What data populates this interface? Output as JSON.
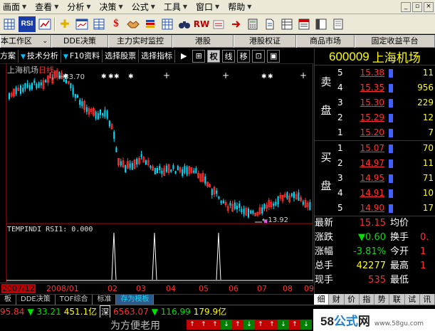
{
  "menubar": {
    "items": [
      {
        "label": "画面"
      },
      {
        "label": "查看"
      },
      {
        "label": "分析"
      },
      {
        "label": "决策"
      },
      {
        "label": "公式"
      },
      {
        "label": "工具"
      },
      {
        "label": "窗口"
      },
      {
        "label": "帮助"
      }
    ],
    "window_controls": [
      "_",
      "▫",
      "×"
    ]
  },
  "toolbar": {
    "icons": [
      "grid-icon",
      "rsi-icon",
      "chart-icon",
      "cross-icon",
      "chart-window-icon",
      "grid-icon",
      "dollar-icon",
      "handshake-icon",
      "stack-icon",
      "grid-icon",
      "binoculars-icon",
      "rw-icon",
      "stack-icon",
      "arrow-icon",
      "calculator-icon",
      "document-icon",
      "grid-icon",
      "list-icon",
      "panel-icon",
      "page-icon"
    ],
    "rsi_label": "RSI",
    "rw_label": "RW"
  },
  "tabs_top": [
    "本工作区",
    "DDE决策",
    "主力实时监控",
    "港股",
    "港股权证",
    "商品市场",
    "固定收益平台"
  ],
  "tabs_second": [
    "方案",
    "技术分析",
    "F10资料",
    "选择股票",
    "选择指标"
  ],
  "chart_toolbar": {
    "play": "▶",
    "plus": "⊞",
    "quan": "权",
    "xian": "线",
    "yi": "移",
    "zoom": "⊡",
    "copy": "▣"
  },
  "chart": {
    "stock_name": "上海机场",
    "period": "日线",
    "high_label": "←33.70",
    "low_label": "←13.92",
    "indicator_label": "TEMPINDI RSI1: 0.000",
    "time_labels": [
      "2007/12",
      "2008/01",
      "02",
      "03",
      "04",
      "05",
      "06",
      "07",
      "08",
      "09"
    ]
  },
  "quote": {
    "code": "600009",
    "name": "上海机场",
    "sell_side_label_1": "卖",
    "sell_side_label_2": "盘",
    "buy_side_label_1": "买",
    "buy_side_label_2": "盘",
    "asks": [
      {
        "level": "5",
        "price": "15.38",
        "volume": "11"
      },
      {
        "level": "4",
        "price": "15.35",
        "volume": "956"
      },
      {
        "level": "3",
        "price": "15.30",
        "volume": "229"
      },
      {
        "level": "2",
        "price": "15.29",
        "volume": "12"
      },
      {
        "level": "1",
        "price": "15.20",
        "volume": "7"
      }
    ],
    "bids": [
      {
        "level": "1",
        "price": "15.07",
        "volume": "70"
      },
      {
        "level": "2",
        "price": "14.97",
        "volume": "11"
      },
      {
        "level": "3",
        "price": "14.95",
        "volume": "71"
      },
      {
        "level": "4",
        "price": "14.91",
        "volume": "10"
      },
      {
        "level": "5",
        "price": "14.90",
        "volume": "17"
      }
    ],
    "stats": [
      {
        "label": "最新",
        "value": "15.15",
        "label2": "均价",
        "value2": ""
      },
      {
        "label": "涨跌",
        "value": "▼0.60",
        "label2": "换手",
        "value2": "0."
      },
      {
        "label": "涨幅",
        "value": "-3.81%",
        "label2": "今开",
        "value2": "1"
      },
      {
        "label": "总手",
        "value": "42277",
        "label2": "最高",
        "value2": "1"
      },
      {
        "label": "现手",
        "value": "535",
        "label2": "最低",
        "value2": ""
      }
    ]
  },
  "bottom_tabs": [
    "板",
    "DDE决策",
    "TOF综合",
    "标准",
    "存为模板"
  ],
  "right_tabs": [
    "细",
    "财",
    "价",
    "指",
    "势",
    "联",
    "试",
    "讯"
  ],
  "ticker": {
    "t1": "95.84",
    "t2": "▼ 33.21",
    "t3": "451.1亿",
    "t4": "深",
    "t5": "6563.07",
    "t6": "▼ 116.99",
    "t7": "179.9亿"
  },
  "status": {
    "text": "为方便老用",
    "arrows": [
      "↑",
      "↑",
      "↑",
      "↓",
      "↑",
      "↓",
      "↑",
      "↑",
      "↓",
      "↑",
      "↓"
    ]
  },
  "watermark": {
    "brand_a": "58",
    "brand_b": "公式",
    "brand_c": "网",
    "url": "www.58gu.com"
  },
  "colors": {
    "up": "#ff3030",
    "down": "#00e0ff",
    "accent_red": "#c00000",
    "yellow": "#ffff00"
  }
}
